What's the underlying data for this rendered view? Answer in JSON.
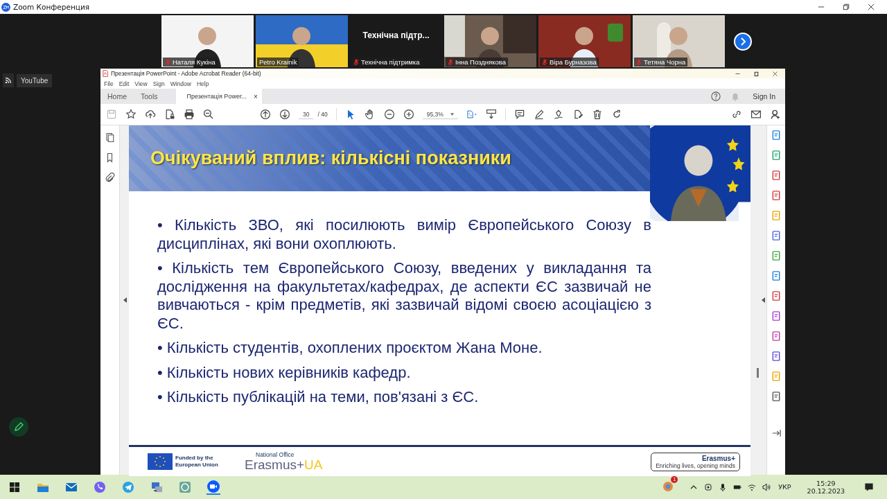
{
  "zoom_window": {
    "title": "Zoom Конференция"
  },
  "participants": [
    {
      "kind": "video",
      "name": "Наталя Кукіна",
      "muted": true
    },
    {
      "kind": "video",
      "name": "Petro Krainik",
      "muted": false
    },
    {
      "kind": "text",
      "label": "Технічна підтр...",
      "name": "Технічна підтримка",
      "muted": true
    },
    {
      "kind": "video",
      "name": "Інна Позднякова",
      "muted": true
    },
    {
      "kind": "video",
      "name": "Віра Бурназова",
      "muted": true
    },
    {
      "kind": "video",
      "name": "Тетяна Чорна",
      "muted": true
    }
  ],
  "side_widget": {
    "label": "YouTube"
  },
  "reader": {
    "title": "Презентація PowerPoint - Adobe Acrobat Reader (64-bit)",
    "menu": [
      "File",
      "Edit",
      "View",
      "Sign",
      "Window",
      "Help"
    ],
    "tabs": [
      {
        "label": "Home",
        "selected": false
      },
      {
        "label": "Tools",
        "selected": false
      },
      {
        "label": "Презентація Power...",
        "selected": true,
        "close": "×"
      }
    ],
    "sign_in": "Sign In",
    "page": {
      "current": "30",
      "total": "/ 40"
    },
    "zoom_level": "95,3%"
  },
  "slide": {
    "title": "Очікуваний вплив: кількісні показники",
    "bullets": [
      "• Кількість ЗВО, які посилюють вимір Європейського Союзу в дисциплінах, які вони охоплюють.",
      "• Кількість тем Європейського Союзу, введених у викладання та дослідження на факультетах/кафедрах, де аспекти ЄС зазвичай не вивчаються - крім предметів, які зазвичай відомі своєю асоціацією з ЄС.",
      "• Кількість студентів, охоплених проєктом Жана Моне.",
      "• Кількість нових керівників кафедр.",
      "• Кількість публікацій на теми, пов'язані з ЄС."
    ],
    "footer": {
      "funded": "Funded by the European Union",
      "national_office": "National Office",
      "erasmus": "Erasmus+",
      "ua": "UA",
      "badge_title": "Erasmus+",
      "badge_subtitle": "Enriching lives, opening minds"
    }
  },
  "taskbar": {
    "notification_count": "1",
    "language": "УКР",
    "time": "15:29",
    "date": "20.12.2023"
  }
}
